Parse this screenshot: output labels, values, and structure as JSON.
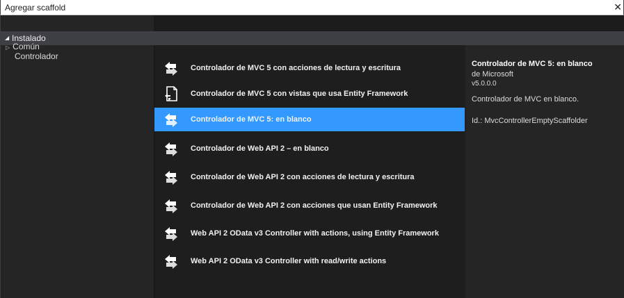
{
  "window": {
    "title": "Agregar scaffold",
    "close_glyph": "✕"
  },
  "tree": {
    "header": "Instalado",
    "header_icon": "triangle-down-icon",
    "items": [
      {
        "label": "Común",
        "icon": "triangle-right-icon"
      },
      {
        "label": "Controlador"
      }
    ]
  },
  "templates": [
    {
      "label": "Controlador de MVC 5 con acciones de lectura y escritura",
      "icon": "controller-icon",
      "selected": false
    },
    {
      "label": "Controlador de MVC 5 con vistas que usa Entity Framework",
      "icon": "view-controller-icon",
      "selected": false
    },
    {
      "label": "Controlador de MVC 5: en blanco",
      "icon": "controller-icon",
      "selected": true
    },
    {
      "label": "Controlador de Web API 2 – en blanco",
      "icon": "controller-icon",
      "selected": false
    },
    {
      "label": "Controlador de Web API 2 con acciones de lectura y escritura",
      "icon": "controller-icon",
      "selected": false
    },
    {
      "label": "Controlador de Web API 2 con acciones que usan Entity Framework",
      "icon": "controller-icon",
      "selected": false
    },
    {
      "label": "Web API 2 OData v3 Controller with actions, using Entity Framework",
      "icon": "controller-icon",
      "selected": false
    },
    {
      "label": "Web API 2 OData v3 Controller with read/write actions",
      "icon": "controller-icon",
      "selected": false
    }
  ],
  "details": {
    "title": "Controlador de MVC 5: en blanco",
    "author": "de Microsoft",
    "version": "v5.0.0.0",
    "description": "Controlador de MVC en blanco.",
    "id": "Id.: MvcControllerEmptyScaffolder"
  },
  "colors": {
    "selection": "#3399ff",
    "background": "#1e1e1e",
    "header": "#3f3f46"
  }
}
